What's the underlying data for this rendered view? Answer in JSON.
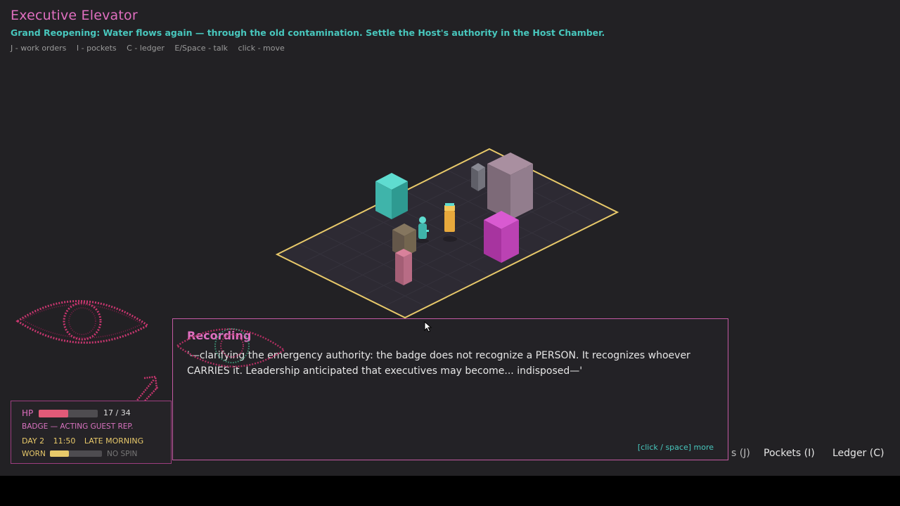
{
  "header": {
    "room_title": "Executive Elevator",
    "objective": "Grand Reopening: Water flows again — through the old contamination. Settle the Host's authority in the Host Chamber.",
    "hints": [
      "J - work orders",
      "I - pockets",
      "C - ledger",
      "E/Space - talk",
      "click - move"
    ]
  },
  "stats": {
    "hp_label": "HP",
    "hp_text": "17 / 34",
    "hp_fraction": 0.5,
    "badge": "BADGE — ACTING GUEST REP.",
    "day": "DAY 2",
    "time": "11:50",
    "period": "LATE MORNING",
    "worn_label": "WORN",
    "worn_fraction": 0.37,
    "spin_label": "NO SPIN"
  },
  "dialog": {
    "speaker": "Recording",
    "text": "'—clarifying the emergency authority: the badge does not recognize a PERSON. It recognizes whoever CARRIES it. Leadership anticipated that executives may become... indisposed—'",
    "more_hint": "[click / space]  more"
  },
  "buttons": {
    "orders_partial": "s (J)",
    "pockets": "Pockets (I)",
    "ledger": "Ledger (C)"
  },
  "colors": {
    "accent_pink": "#e06fc0",
    "accent_teal": "#48c7bd",
    "accent_gold": "#e8c96a",
    "floor_outline": "#e8c96a",
    "hp_fill": "#e25a78"
  },
  "icons": [
    "eye-doodle-icon",
    "arrow-doodle-icon",
    "cursor-icon"
  ]
}
